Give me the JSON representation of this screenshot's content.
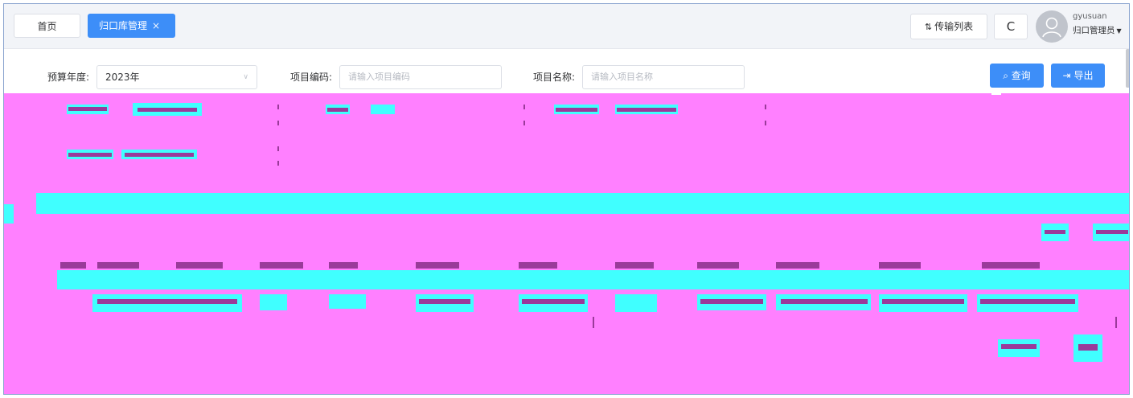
{
  "topbar": {
    "tabs": [
      {
        "label": "首页",
        "active": false
      },
      {
        "label": "归口库管理",
        "active": true,
        "close": "×"
      }
    ],
    "transfer_list": "传输列表",
    "transfer_icon": "⇅",
    "refresh_icon": "C",
    "user": {
      "name": "gyusuan",
      "role": "归口管理员",
      "caret": "▼"
    }
  },
  "search": {
    "year_label": "预算年度:",
    "year_value": "2023年",
    "code_label": "项目编码:",
    "code_placeholder": "请输入项目编码",
    "name_label": "项目名称:",
    "name_placeholder": "请输入项目名称",
    "query_label": "查询",
    "query_icon": "⌕",
    "export_label": "导出",
    "export_icon": "⇥"
  },
  "colors": {
    "primary": "#3d8ef8",
    "glitch_magenta": "#ff80ff",
    "glitch_cyan": "#40ffff"
  }
}
